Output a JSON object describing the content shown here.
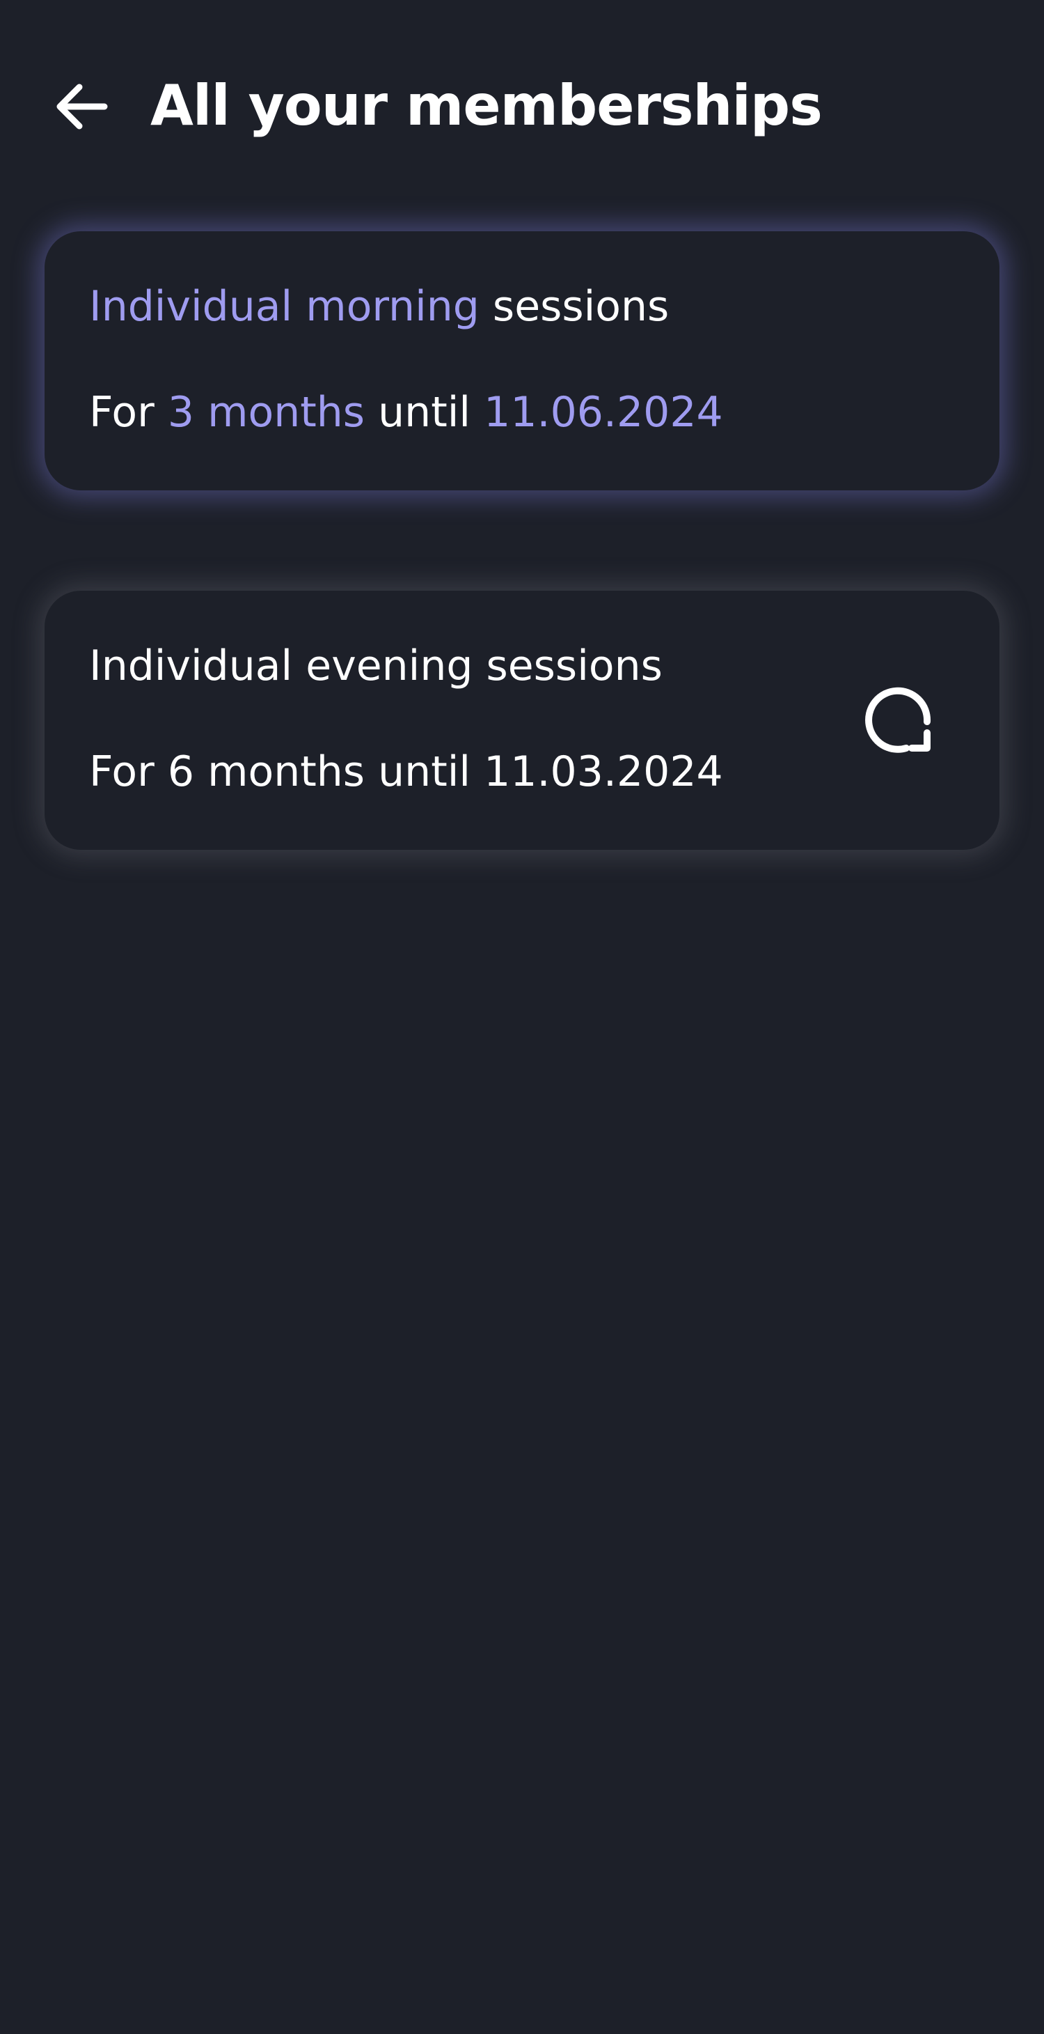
{
  "header": {
    "title": "All your memberships",
    "back_icon": "arrow-left-icon"
  },
  "colors": {
    "background": "#1d2029",
    "accent": "#9f9cf0",
    "text": "#ffffff",
    "active_glow": "#7a7ad6"
  },
  "memberships": [
    {
      "type_accent": "Individual morning",
      "type_rest": " sessions",
      "prefix": "For ",
      "duration": "3 months",
      "until": " until ",
      "date": "11.06.2024",
      "active": true
    },
    {
      "title": "Individual evening sessions",
      "duration_line": "For 6 months until 11.03.2024",
      "active": false,
      "action_icon": "renew-icon"
    }
  ]
}
